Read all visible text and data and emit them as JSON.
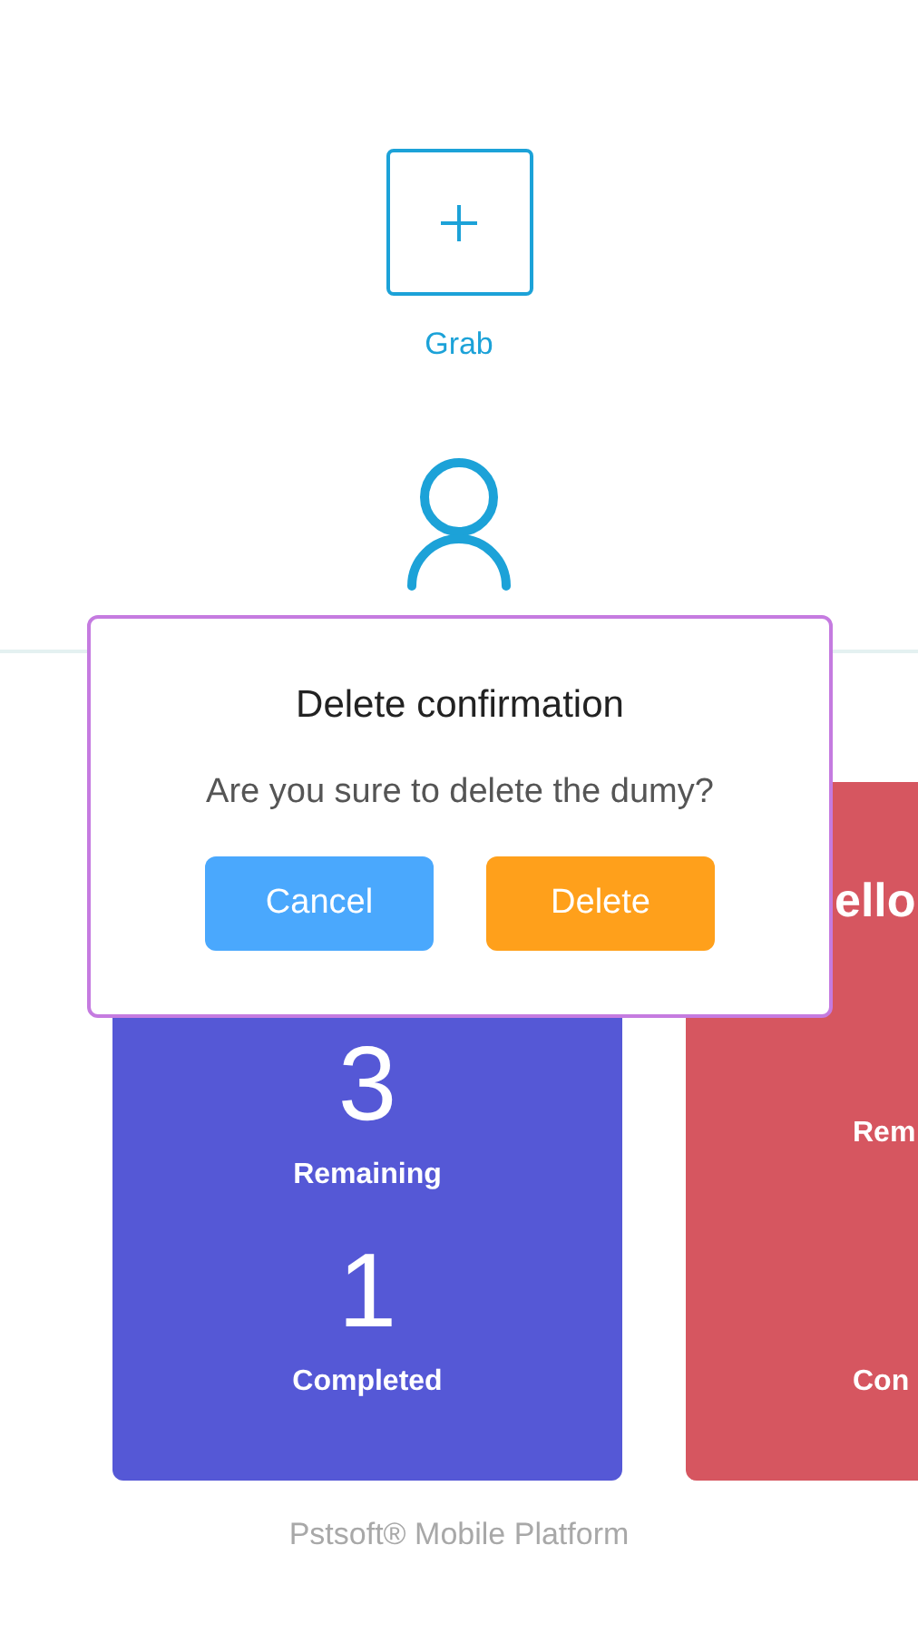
{
  "grab": {
    "label": "Grab"
  },
  "cards": [
    {
      "color": "#5558d6",
      "stats": [
        {
          "value": "3",
          "label": "Remaining"
        },
        {
          "value": "1",
          "label": "Completed"
        }
      ],
      "cut": false
    },
    {
      "title": "ello",
      "color": "#d65660",
      "stats": [
        {
          "label": "Rem"
        },
        {
          "label": "Con"
        }
      ],
      "cut": true
    }
  ],
  "footer": "Pstsoft® Mobile Platform",
  "dialog": {
    "title": "Delete confirmation",
    "message": "Are you sure to delete the dumy?",
    "buttons": [
      {
        "label": "Cancel",
        "kind": "cancel"
      },
      {
        "label": "Delete",
        "kind": "confirm"
      }
    ]
  }
}
